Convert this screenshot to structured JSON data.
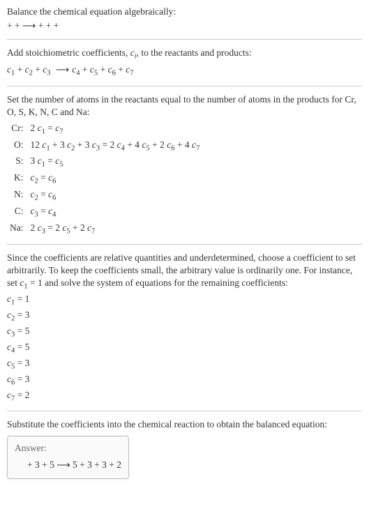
{
  "intro": {
    "line1": "Balance the chemical equation algebraically:",
    "reaction_template": " +  +  ⟶  +  +  + "
  },
  "stoich": {
    "text": "Add stoichiometric coefficients, ",
    "ci": "c",
    "ci_sub": "i",
    "text2": ", to the reactants and products:",
    "lhs": [
      {
        "c": "c",
        "s": "1"
      },
      {
        "c": "c",
        "s": "2"
      },
      {
        "c": "c",
        "s": "3"
      }
    ],
    "rhs": [
      {
        "c": "c",
        "s": "4"
      },
      {
        "c": "c",
        "s": "5"
      },
      {
        "c": "c",
        "s": "6"
      },
      {
        "c": "c",
        "s": "7"
      }
    ]
  },
  "atoms": {
    "text": "Set the number of atoms in the reactants equal to the number of atoms in the products for Cr, O, S, K, N, C and Na:",
    "rows": [
      {
        "el": "Cr:",
        "eq_parts": [
          {
            "t": "2 "
          },
          {
            "c": "c",
            "s": "1"
          },
          {
            "t": " = "
          },
          {
            "c": "c",
            "s": "7"
          }
        ]
      },
      {
        "el": "O:",
        "eq_parts": [
          {
            "t": "12 "
          },
          {
            "c": "c",
            "s": "1"
          },
          {
            "t": " + 3 "
          },
          {
            "c": "c",
            "s": "2"
          },
          {
            "t": " + 3 "
          },
          {
            "c": "c",
            "s": "3"
          },
          {
            "t": " = 2 "
          },
          {
            "c": "c",
            "s": "4"
          },
          {
            "t": " + 4 "
          },
          {
            "c": "c",
            "s": "5"
          },
          {
            "t": " + 2 "
          },
          {
            "c": "c",
            "s": "6"
          },
          {
            "t": " + 4 "
          },
          {
            "c": "c",
            "s": "7"
          }
        ]
      },
      {
        "el": "S:",
        "eq_parts": [
          {
            "t": "3 "
          },
          {
            "c": "c",
            "s": "1"
          },
          {
            "t": " = "
          },
          {
            "c": "c",
            "s": "5"
          }
        ]
      },
      {
        "el": "K:",
        "eq_parts": [
          {
            "c": "c",
            "s": "2"
          },
          {
            "t": " = "
          },
          {
            "c": "c",
            "s": "6"
          }
        ]
      },
      {
        "el": "N:",
        "eq_parts": [
          {
            "c": "c",
            "s": "2"
          },
          {
            "t": " = "
          },
          {
            "c": "c",
            "s": "6"
          }
        ]
      },
      {
        "el": "C:",
        "eq_parts": [
          {
            "c": "c",
            "s": "3"
          },
          {
            "t": " = "
          },
          {
            "c": "c",
            "s": "4"
          }
        ]
      },
      {
        "el": "Na:",
        "eq_parts": [
          {
            "t": "2 "
          },
          {
            "c": "c",
            "s": "3"
          },
          {
            "t": " = 2 "
          },
          {
            "c": "c",
            "s": "5"
          },
          {
            "t": " + 2 "
          },
          {
            "c": "c",
            "s": "7"
          }
        ]
      }
    ]
  },
  "choose": {
    "text_a": "Since the coefficients are relative quantities and underdetermined, choose a coefficient to set arbitrarily. To keep the coefficients small, the arbitrary value is ordinarily one. For instance, set ",
    "c": "c",
    "s": "1",
    "text_b": " = 1 and solve the system of equations for the remaining coefficients:",
    "solutions": [
      {
        "c": "c",
        "s": "1",
        "v": "1"
      },
      {
        "c": "c",
        "s": "2",
        "v": "3"
      },
      {
        "c": "c",
        "s": "3",
        "v": "5"
      },
      {
        "c": "c",
        "s": "4",
        "v": "5"
      },
      {
        "c": "c",
        "s": "5",
        "v": "3"
      },
      {
        "c": "c",
        "s": "6",
        "v": "3"
      },
      {
        "c": "c",
        "s": "7",
        "v": "2"
      }
    ]
  },
  "subst": {
    "text": "Substitute the coefficients into the chemical reaction to obtain the balanced equation:"
  },
  "answer": {
    "label": "Answer:",
    "eq": " + 3  + 5  ⟶ 5  + 3  + 3  + 2 "
  }
}
